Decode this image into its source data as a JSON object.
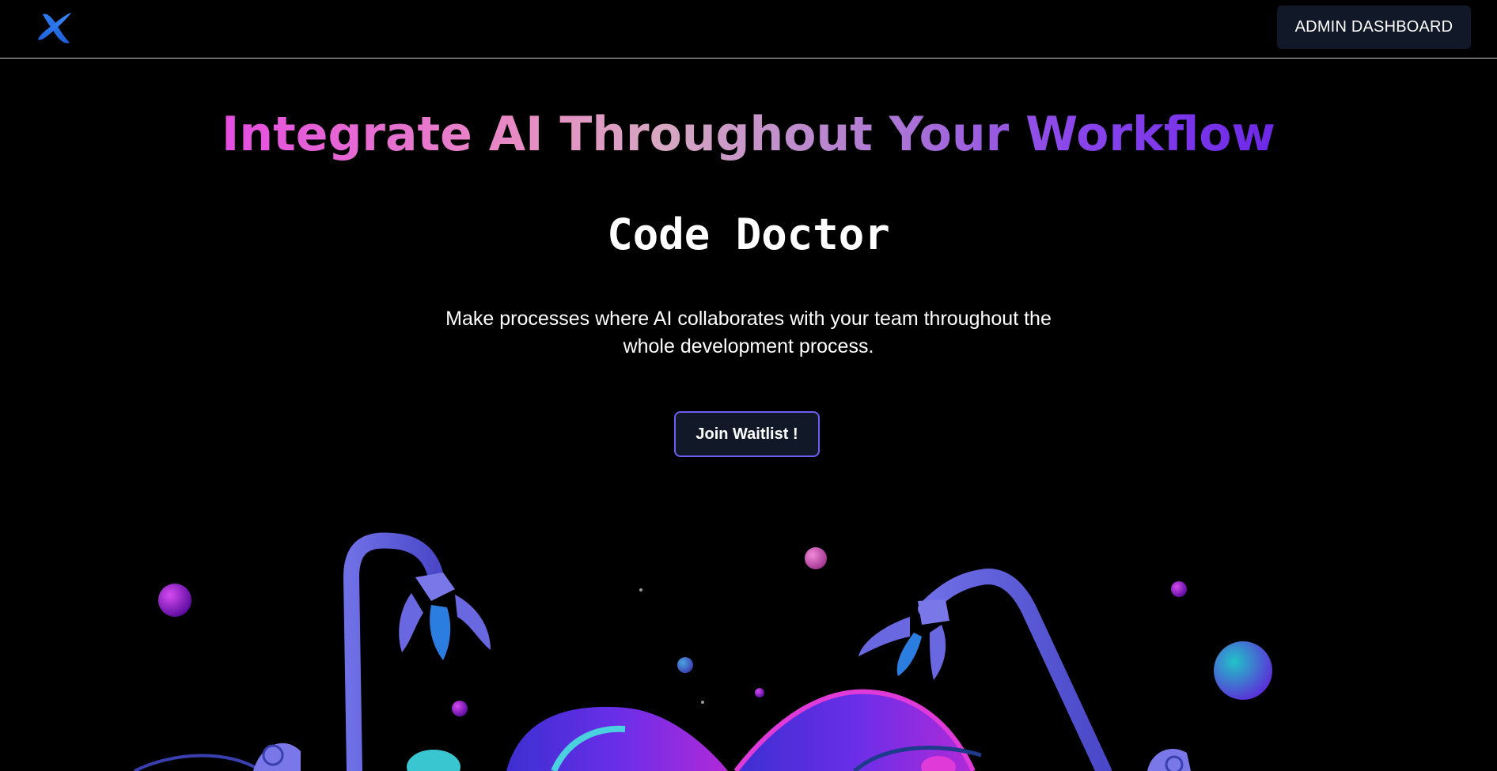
{
  "header": {
    "logo_icon": "x-logo-icon",
    "admin_button_label": "ADMIN DASHBOARD"
  },
  "hero": {
    "headline": "Integrate AI Throughout Your Workflow",
    "title": "Code Doctor",
    "description": "Make processes where AI collaborates with your team throughout the whole development process.",
    "cta_label": "Join Waitlist !"
  },
  "colors": {
    "background": "#000000",
    "button_bg": "#111827",
    "cta_border": "#6d5df2",
    "gradient_start": "#e44de0",
    "gradient_end": "#6d28e8"
  }
}
